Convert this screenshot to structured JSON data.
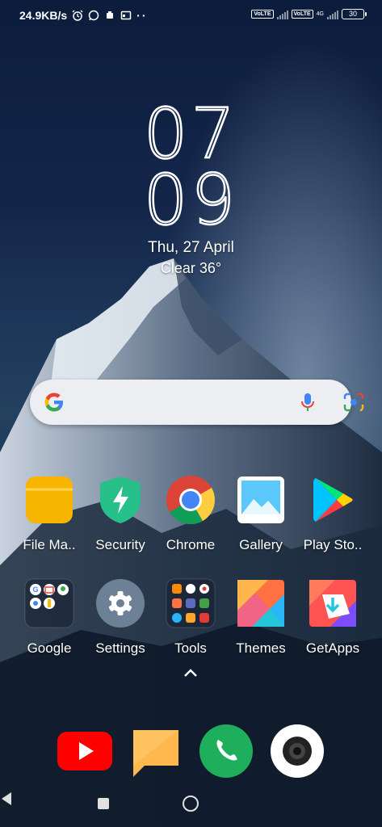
{
  "status": {
    "speed": "24.9KB/s",
    "network1": "VoLTE",
    "network2": "VoLTE",
    "net_type": "4G",
    "battery": "30"
  },
  "clock": {
    "hour": "07",
    "minute": "09"
  },
  "date": "Thu, 27 April",
  "weather": "Clear  36°",
  "search": {
    "placeholder": ""
  },
  "apps_row1": [
    {
      "label": "File Ma..",
      "icon": "folder-icon"
    },
    {
      "label": "Security",
      "icon": "shield-icon"
    },
    {
      "label": "Chrome",
      "icon": "chrome-icon"
    },
    {
      "label": "Gallery",
      "icon": "gallery-icon"
    },
    {
      "label": "Play Sto..",
      "icon": "play-store-icon"
    }
  ],
  "apps_row2": [
    {
      "label": "Google",
      "icon": "google-folder-icon"
    },
    {
      "label": "Settings",
      "icon": "gear-icon"
    },
    {
      "label": "Tools",
      "icon": "tools-folder-icon"
    },
    {
      "label": "Themes",
      "icon": "themes-icon"
    },
    {
      "label": "GetApps",
      "icon": "getapps-icon"
    }
  ],
  "dock": [
    "youtube-icon",
    "messages-icon",
    "phone-icon",
    "camera-icon"
  ],
  "colors": {
    "youtube": "#ff0000",
    "messages": "#ffb84d",
    "phone": "#1fae5b",
    "folder": "#f7b500",
    "security": "#27c08a"
  }
}
